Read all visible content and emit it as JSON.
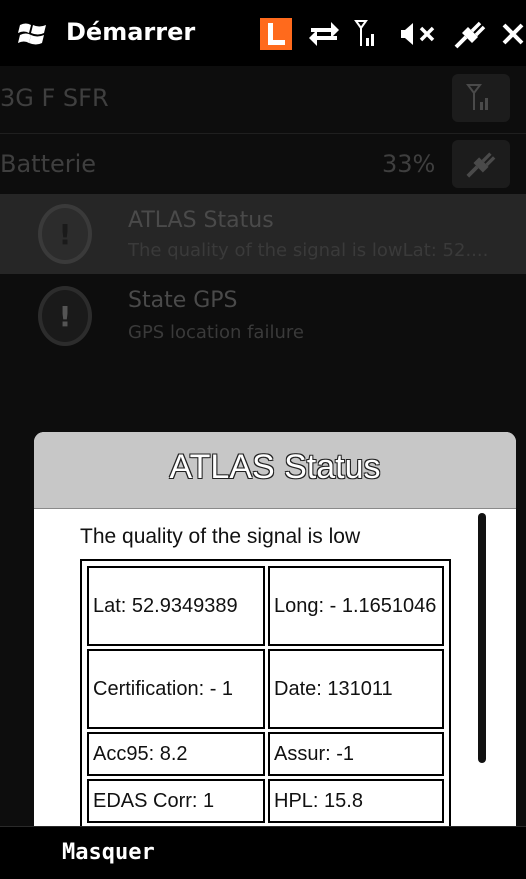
{
  "status_bar": {
    "start_label": "Démarrer",
    "icons": [
      "windows-logo-icon",
      "l-app-icon",
      "data-transfer-icon",
      "signal-strength-icon",
      "speaker-muted-icon",
      "power-plug-icon",
      "close-icon"
    ],
    "accent_color": "#ff6a1c"
  },
  "background_list": {
    "network": {
      "label": "3G F SFR"
    },
    "battery": {
      "label": "Batterie",
      "value": "33%"
    },
    "notifications": [
      {
        "title": "ATLAS Status",
        "subtitle": "The quality of the signal is lowLat: 52...."
      },
      {
        "title": "State GPS",
        "subtitle": "GPS location failure"
      }
    ]
  },
  "dialog": {
    "title": "ATLAS Status",
    "message": "The quality of the signal is low",
    "table": [
      [
        "Lat: 52.9349389",
        "Long: - 1.1651046"
      ],
      [
        "Certification: - 1",
        "Date: 131011"
      ],
      [
        "Acc95: 8.2",
        "Assur: -1"
      ],
      [
        "EDAS Corr: 1",
        "HPL: 15.8"
      ]
    ]
  },
  "bottom_bar": {
    "softkey_label": "Masquer"
  }
}
